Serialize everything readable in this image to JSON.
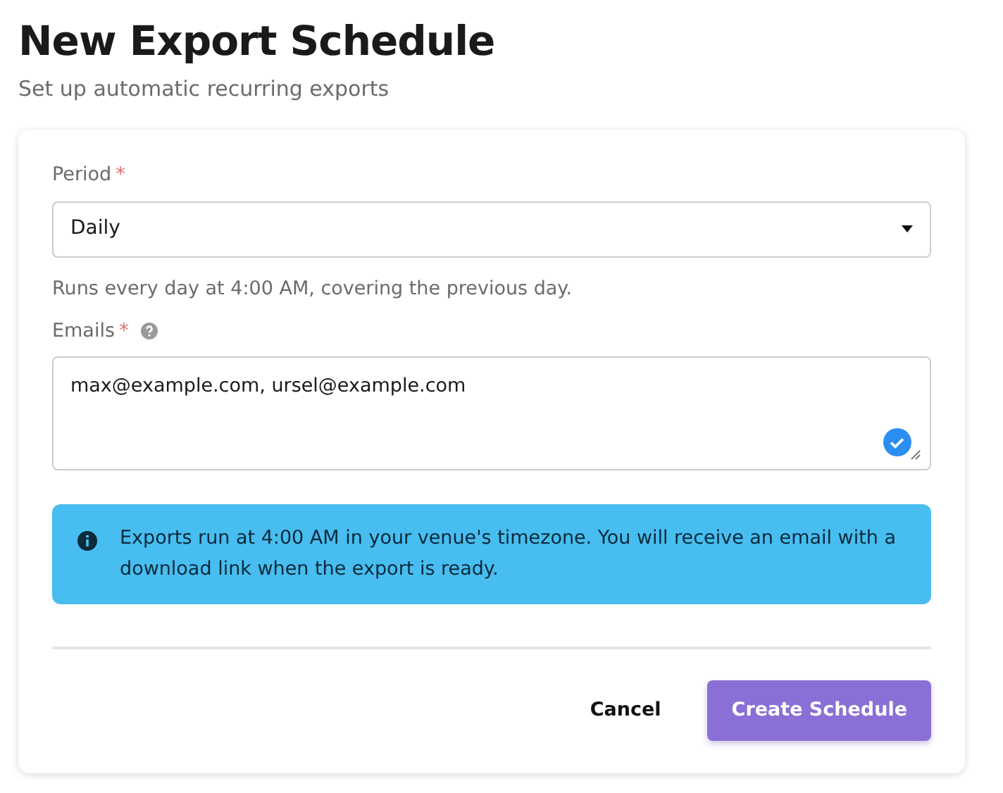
{
  "header": {
    "title": "New Export Schedule",
    "subtitle": "Set up automatic recurring exports"
  },
  "fields": [
    {
      "kind": "select",
      "label": "Period",
      "required_mark": "*",
      "value": "Daily",
      "help": "Runs every day at 4:00 AM, covering the previous day."
    },
    {
      "kind": "textarea",
      "label": "Emails",
      "required_mark": "*",
      "has_hint": true,
      "value": "max@example.com, ursel@example.com",
      "valid": true
    }
  ],
  "alert": {
    "text": "Exports run at 4:00 AM in your venue's timezone. You will receive an email with a download link when the export is ready."
  },
  "buttons": [
    {
      "kind": "secondary",
      "label": "Cancel"
    },
    {
      "kind": "primary",
      "label": "Create Schedule"
    }
  ]
}
